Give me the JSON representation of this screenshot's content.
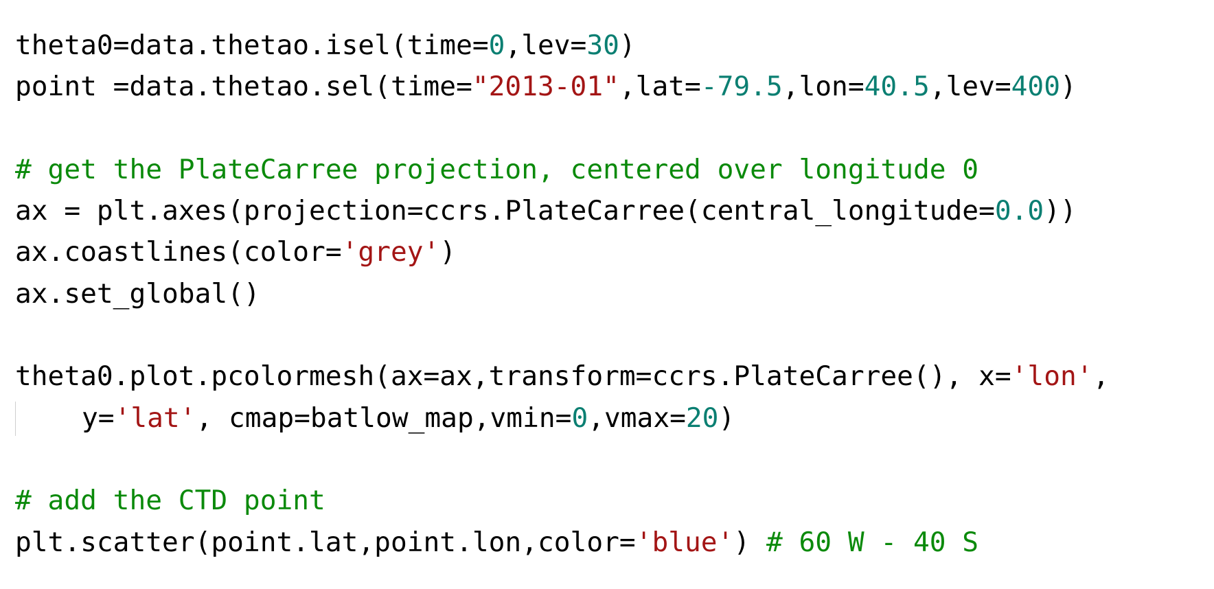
{
  "code_cell": {
    "lines": [
      {
        "tokens": [
          {
            "t": "theta0=data.thetao.isel(time=",
            "k": "plain"
          },
          {
            "t": "0",
            "k": "num"
          },
          {
            "t": ",lev=",
            "k": "plain"
          },
          {
            "t": "30",
            "k": "num"
          },
          {
            "t": ")",
            "k": "plain"
          }
        ]
      },
      {
        "tokens": [
          {
            "t": "point =data.thetao.sel(time=",
            "k": "plain"
          },
          {
            "t": "\"2013-01\"",
            "k": "str"
          },
          {
            "t": ",lat=",
            "k": "plain"
          },
          {
            "t": "-79.5",
            "k": "num"
          },
          {
            "t": ",lon=",
            "k": "plain"
          },
          {
            "t": "40.5",
            "k": "num"
          },
          {
            "t": ",lev=",
            "k": "plain"
          },
          {
            "t": "400",
            "k": "num"
          },
          {
            "t": ")",
            "k": "plain"
          }
        ]
      },
      {
        "tokens": []
      },
      {
        "tokens": [
          {
            "t": "# get the PlateCarree projection, centered over longitude 0",
            "k": "com"
          }
        ]
      },
      {
        "tokens": [
          {
            "t": "ax = plt.axes(projection=ccrs.PlateCarree(central_longitude=",
            "k": "plain"
          },
          {
            "t": "0.0",
            "k": "num"
          },
          {
            "t": "))",
            "k": "plain"
          }
        ]
      },
      {
        "tokens": [
          {
            "t": "ax.coastlines(color=",
            "k": "plain"
          },
          {
            "t": "'grey'",
            "k": "str"
          },
          {
            "t": ")",
            "k": "plain"
          }
        ]
      },
      {
        "tokens": [
          {
            "t": "ax.set_global()",
            "k": "plain"
          }
        ]
      },
      {
        "tokens": []
      },
      {
        "tokens": [
          {
            "t": "theta0.plot.pcolormesh(ax=ax,transform=ccrs.PlateCarree(), x=",
            "k": "plain"
          },
          {
            "t": "'lon'",
            "k": "str"
          },
          {
            "t": ",",
            "k": "plain"
          }
        ]
      },
      {
        "continuation": true,
        "tokens": [
          {
            "t": "y=",
            "k": "plain"
          },
          {
            "t": "'lat'",
            "k": "str"
          },
          {
            "t": ", cmap=batlow_map,vmin=",
            "k": "plain"
          },
          {
            "t": "0",
            "k": "num"
          },
          {
            "t": ",vmax=",
            "k": "plain"
          },
          {
            "t": "20",
            "k": "num"
          },
          {
            "t": ")",
            "k": "plain"
          }
        ]
      },
      {
        "tokens": []
      },
      {
        "tokens": [
          {
            "t": "# add the CTD point",
            "k": "com"
          }
        ]
      },
      {
        "tokens": [
          {
            "t": "plt.scatter(point.lat,point.lon,color=",
            "k": "plain"
          },
          {
            "t": "'blue'",
            "k": "str"
          },
          {
            "t": ") ",
            "k": "plain"
          },
          {
            "t": "# 60 W - 40 S",
            "k": "com"
          }
        ]
      }
    ]
  },
  "colors": {
    "text": "#000000",
    "number": "#0b7f72",
    "string": "#a31515",
    "comment": "#0b8a0b",
    "wrap_bar": "#cfcfcf",
    "background": "#ffffff"
  }
}
